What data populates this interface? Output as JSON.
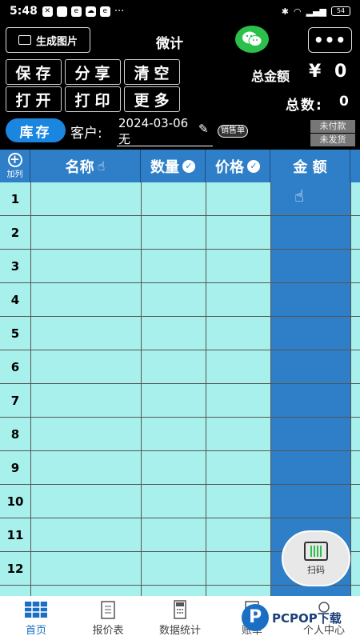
{
  "status_bar": {
    "time": "5:48",
    "battery": "54"
  },
  "header": {
    "generate_label": "生成图片",
    "title": "微计",
    "more_label": "•••"
  },
  "actions": {
    "save": "保存",
    "share": "分享",
    "clear": "清空",
    "open": "打开",
    "print": "打印",
    "more": "更多"
  },
  "summary": {
    "total_amount_label": "总金额",
    "currency": "¥",
    "total_amount": "0",
    "total_count_label": "总数:",
    "total_count": "0"
  },
  "customer": {
    "stock_label": "库存",
    "label": "客户:",
    "date": "2024-03-06",
    "name": "无",
    "doc_type": "销售单",
    "unpaid": "未付款",
    "unshipped": "未发货"
  },
  "table": {
    "add_column_label": "加列",
    "columns": [
      "名称",
      "数量",
      "价格",
      "金 额"
    ],
    "rows": [
      "1",
      "2",
      "3",
      "4",
      "5",
      "6",
      "7",
      "8",
      "9",
      "10",
      "11",
      "12"
    ]
  },
  "scan": {
    "label": "扫码"
  },
  "nav": {
    "items": [
      {
        "label": "首页"
      },
      {
        "label": "报价表"
      },
      {
        "label": "数据统计"
      },
      {
        "label": "账单"
      },
      {
        "label": "个人中心"
      }
    ]
  },
  "watermark": {
    "text": "PCPOP下载"
  },
  "colors": {
    "accent": "#2e7ec8",
    "table_bg": "#a8f0ec",
    "wechat": "#2bc04a"
  }
}
